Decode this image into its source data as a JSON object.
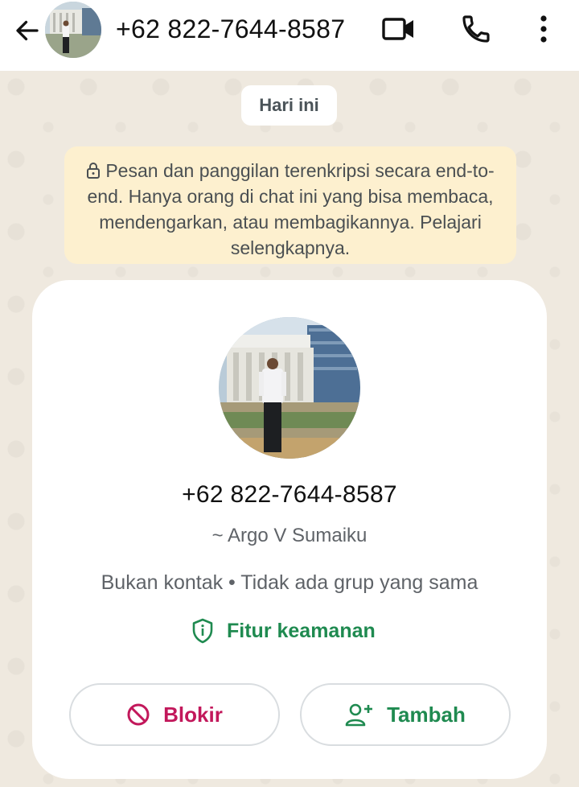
{
  "header": {
    "title": "+62 822-7644-8587",
    "icons": [
      "back-arrow-icon",
      "video-call-icon",
      "voice-call-icon",
      "more-options-icon"
    ]
  },
  "date_chip": "Hari ini",
  "encryption_notice": {
    "text": "Pesan dan panggilan terenkripsi secara end-to-end. Hanya orang di chat ini yang bisa membaca, mendengarkan, atau membagikannya. Pelajari selengkapnya."
  },
  "contact_card": {
    "phone": "+62 822-7644-8587",
    "pushname": "~ Argo V Sumaiku",
    "meta": "Bukan kontak • Tidak ada grup yang sama",
    "security_label": "Fitur keamanan",
    "block_label": "Blokir",
    "add_label": "Tambah"
  },
  "colors": {
    "accent_green": "#1f8a50",
    "block_red": "#c2185b",
    "notice_bg": "#fdf0cf",
    "chat_bg": "#efe9df"
  }
}
